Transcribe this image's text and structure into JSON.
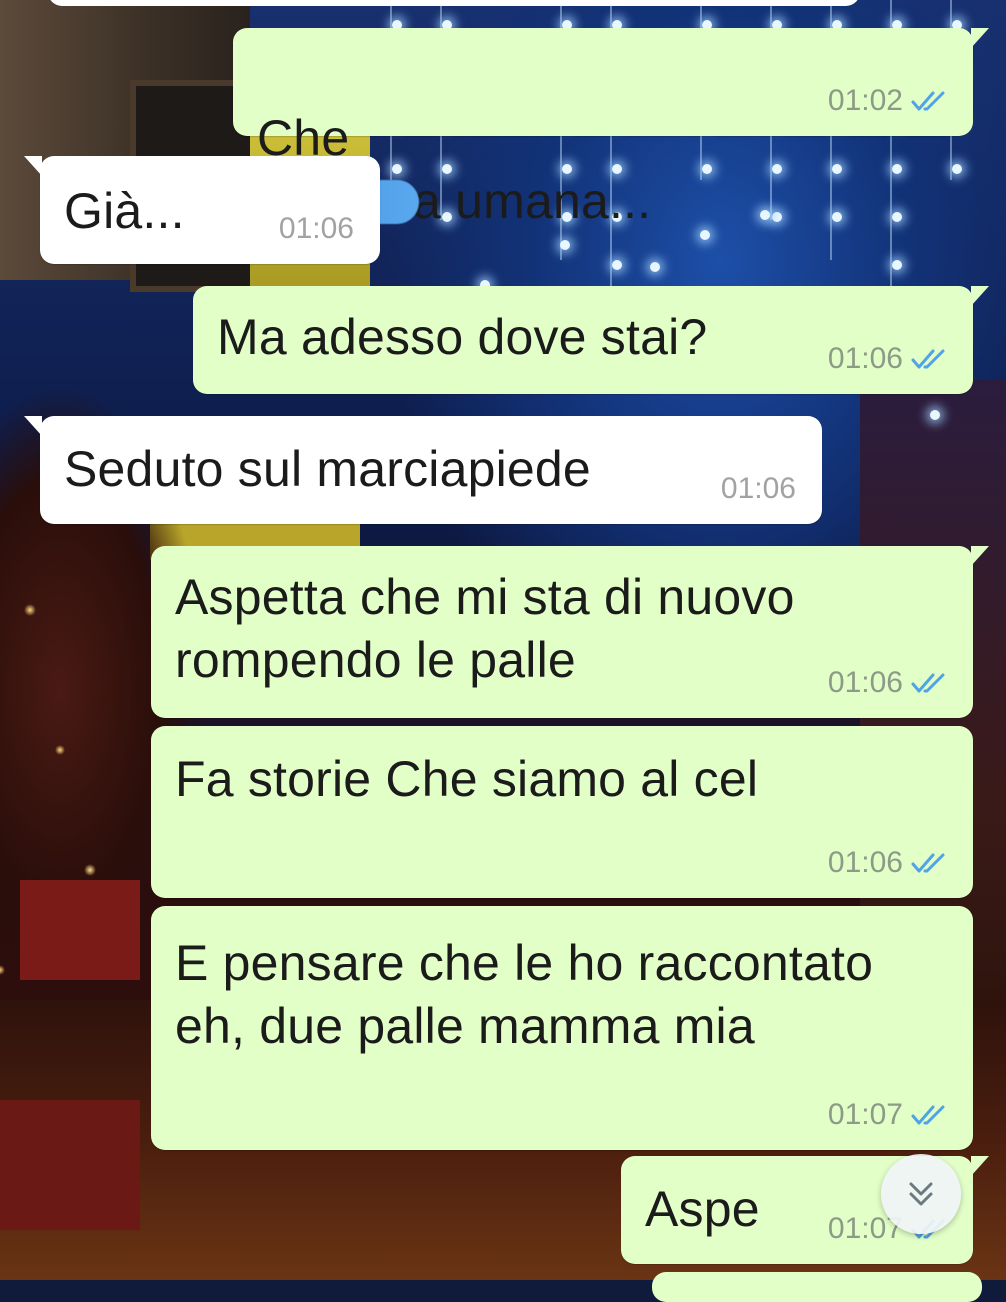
{
  "conversation": {
    "messages": [
      {
        "direction": "outgoing",
        "text_before": "Che",
        "text_after": "a umana...",
        "time": "01:02",
        "status_icon": "double-check-read-icon"
      },
      {
        "direction": "incoming",
        "text": "Già...",
        "time": "01:06"
      },
      {
        "direction": "outgoing",
        "text": "Ma adesso dove stai?",
        "time": "01:06",
        "status_icon": "double-check-read-icon"
      },
      {
        "direction": "incoming",
        "text": "Seduto sul marciapiede",
        "time": "01:06"
      },
      {
        "direction": "outgoing",
        "text": "Aspetta che mi sta di nuovo\nrompendo le palle",
        "time": "01:06",
        "status_icon": "double-check-read-icon"
      },
      {
        "direction": "outgoing",
        "text": "Fa storie Che siamo al cel",
        "time": "01:06",
        "status_icon": "double-check-read-icon"
      },
      {
        "direction": "outgoing",
        "text": "E pensare che le ho raccontato\neh, due palle mamma mia",
        "time": "01:07",
        "status_icon": "double-check-read-icon"
      },
      {
        "direction": "outgoing",
        "text": "Aspe",
        "time": "01:07",
        "status_icon": "double-check-read-icon"
      }
    ]
  },
  "scroll_button": {
    "icon": "double-chevron-down-icon"
  },
  "colors": {
    "outgoing_bubble": "#e2ffc7",
    "incoming_bubble": "#ffffff",
    "read_ticks": "#4fa3e6",
    "redaction": "#4a9be6"
  }
}
